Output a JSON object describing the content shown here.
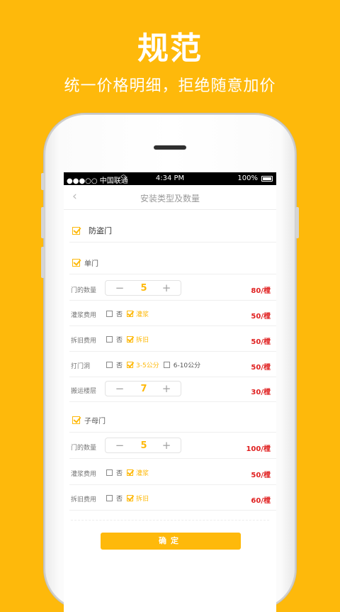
{
  "promo": {
    "headline": "规范",
    "subheadline": "统一价格明细，拒绝随意加价"
  },
  "statusbar": {
    "carrier": "●●●○○ 中国联通",
    "time": "4:34 PM",
    "battery": "100%"
  },
  "navbar": {
    "back": "‹",
    "title": "安装类型及数量"
  },
  "product": {
    "name": "防盗门"
  },
  "sections": {
    "single_door": {
      "label": "单门",
      "qty_label": "门的数量",
      "qty": "5",
      "qty_price": "80/樘",
      "grout_label": "灌浆费用",
      "grout_no": "否",
      "grout_yes": "灌浆",
      "grout_price": "50/樘",
      "remove_label": "拆旧费用",
      "remove_no": "否",
      "remove_yes": "拆旧",
      "remove_price": "50/樘",
      "hole_label": "打门洞",
      "hole_no": "否",
      "hole_opt1": "3-5公分",
      "hole_opt2": "6-10公分",
      "hole_price": "50/樘",
      "floor_label": "搬运楼层",
      "floor_qty": "7",
      "floor_price": "30/樘"
    },
    "mother_door": {
      "label": "子母门",
      "qty_label": "门的数量",
      "qty": "5",
      "qty_price": "100/樘",
      "grout_label": "灌浆费用",
      "grout_no": "否",
      "grout_yes": "灌浆",
      "grout_price": "50/樘",
      "remove_label": "拆旧费用",
      "remove_no": "否",
      "remove_yes": "拆旧",
      "remove_price": "60/樘"
    }
  },
  "stepper": {
    "minus": "−",
    "plus": "+"
  },
  "confirm_label": "确定",
  "colors": {
    "accent": "#FEB90B",
    "price": "#E02020"
  }
}
